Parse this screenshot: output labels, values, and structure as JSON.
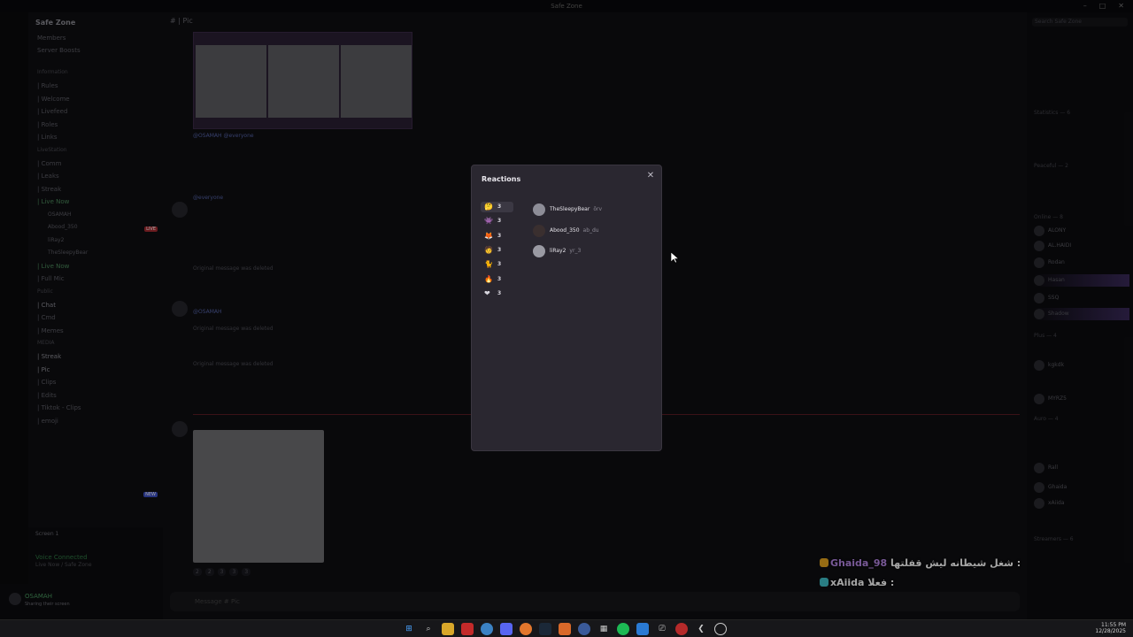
{
  "window": {
    "title": "Safe Zone"
  },
  "sidebar": {
    "server_name": "Safe Zone",
    "top_items": [
      "Members",
      "Server Boosts"
    ],
    "channels": [
      {
        "label": "Information",
        "kind": "cat"
      },
      {
        "label": "| Rules",
        "kind": "ch"
      },
      {
        "label": "| Welcome",
        "kind": "ch"
      },
      {
        "label": "| Livefeed",
        "kind": "ch"
      },
      {
        "label": "| Roles",
        "kind": "ch"
      },
      {
        "label": "| Links",
        "kind": "ch"
      },
      {
        "label": "LiveStation",
        "kind": "cat"
      },
      {
        "label": "| Comm",
        "kind": "ch"
      },
      {
        "label": "| Leaks",
        "kind": "ch"
      },
      {
        "label": "| Streak",
        "kind": "ch"
      },
      {
        "label": "| Live Now",
        "kind": "live"
      },
      {
        "label": "OSAMAH",
        "kind": "voice"
      },
      {
        "label": "Abood_350",
        "kind": "voice"
      },
      {
        "label": "liRay2",
        "kind": "voice"
      },
      {
        "label": "TheSleepyBear",
        "kind": "voice"
      },
      {
        "label": "| Live Now",
        "kind": "live"
      },
      {
        "label": "| Full Mic",
        "kind": "ch"
      },
      {
        "label": "Public",
        "kind": "cat"
      },
      {
        "label": "| Chat",
        "kind": "act"
      },
      {
        "label": "| Cmd",
        "kind": "ch"
      },
      {
        "label": "| Memes",
        "kind": "ch"
      },
      {
        "label": "MEDIA",
        "kind": "cat"
      },
      {
        "label": "| Streak",
        "kind": "act"
      },
      {
        "label": "| Pic",
        "kind": "act"
      },
      {
        "label": "| Clips",
        "kind": "ch"
      },
      {
        "label": "| Edits",
        "kind": "ch"
      },
      {
        "label": "| Tiktok - Clips",
        "kind": "ch"
      },
      {
        "label": "| emoji",
        "kind": "ch"
      }
    ],
    "live_badge": "LIVE",
    "new_badge": "NEW",
    "voice_status": "Voice Connected",
    "voice_sub": "Live Now / Safe Zone",
    "screen_label": "Screen 1",
    "user_name": "OSAMAH",
    "user_status": "Sharing their screen"
  },
  "channel": {
    "name": "Pic",
    "composer_placeholder": "Message # Pic"
  },
  "messages": {
    "m1": "@OSAMAH @everyone",
    "m2": "@everyone",
    "m3": "Original message was deleted",
    "m4": "@OSAMAH",
    "m5": "Original message was deleted",
    "m6": "Original message was deleted"
  },
  "members": {
    "search_placeholder": "Search Safe Zone",
    "groups": [
      {
        "label": "Statistics — 6"
      },
      {
        "label": "Peaceful — 2"
      },
      {
        "label": "Online — 8"
      },
      {
        "label": "Plus — 4"
      },
      {
        "label": "Auro — 4"
      },
      {
        "label": "Streamers — 6"
      }
    ],
    "rows": [
      "ALONY",
      "AL.HAIDI",
      "Rodan",
      "Hasan",
      "SSQ",
      "Shadow",
      "kgkdk",
      "MYRZ5",
      "Rall",
      "Ghaida",
      "xAiida"
    ]
  },
  "stream_overlay": {
    "line1_user": "Ghaida_98",
    "line1_text": "شغل شيطانه ليش قفلتها :",
    "line2_user": "xAiida",
    "line2_text": "فعلا :"
  },
  "reactions_modal": {
    "title": "Reactions",
    "tabs": [
      {
        "emoji": "🤔",
        "count": "3"
      },
      {
        "emoji": "👾",
        "count": "3"
      },
      {
        "emoji": "🦊",
        "count": "3"
      },
      {
        "emoji": "🧑",
        "count": "3"
      },
      {
        "emoji": "🐈",
        "count": "3"
      },
      {
        "emoji": "🔥",
        "count": "3"
      },
      {
        "emoji": "❤",
        "count": "3"
      }
    ],
    "users": [
      {
        "name": "TheSleepyBear",
        "handle": "ōrv"
      },
      {
        "name": "Abood_350",
        "handle": "ab_du"
      },
      {
        "name": "liRay2",
        "handle": "yr_3"
      }
    ]
  },
  "taskbar": {
    "time": "11:55 PM",
    "date": "12/28/2025"
  }
}
